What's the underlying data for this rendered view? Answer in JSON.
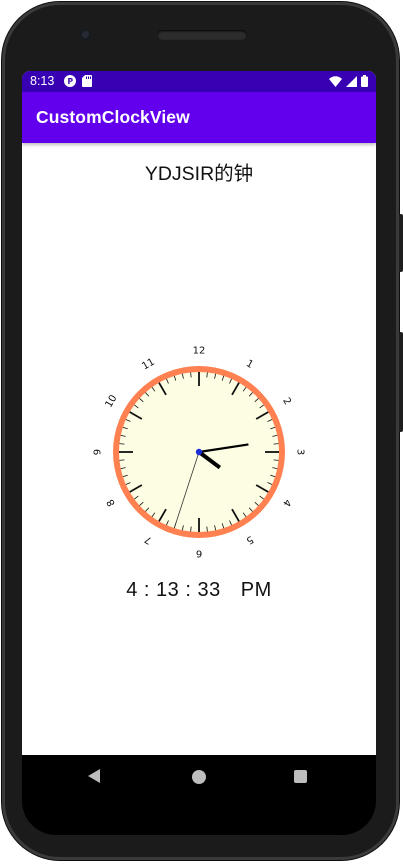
{
  "status_bar": {
    "time": "8:13",
    "left_icons": [
      "p-notification-icon",
      "sd-card-icon"
    ],
    "right_icons": [
      "wifi-icon",
      "signal-icon",
      "battery-icon"
    ],
    "color": "#3700b3"
  },
  "app_bar": {
    "title": "CustomClockView",
    "color": "#6200ee"
  },
  "heading": "YDJSIR的钟",
  "clock": {
    "numbers": [
      "12",
      "1",
      "2",
      "3",
      "4",
      "5",
      "6",
      "7",
      "8",
      "9",
      "10",
      "11"
    ],
    "hour": 4,
    "minute": 13,
    "second": 33,
    "face_color": "#fdfde4",
    "rim_color": "#ff8050"
  },
  "time_display": {
    "hh": "4",
    "mm": "13",
    "ss": "33",
    "period": "PM"
  },
  "nav_bar": {
    "icons": [
      "back-icon",
      "home-icon",
      "recents-icon"
    ]
  }
}
